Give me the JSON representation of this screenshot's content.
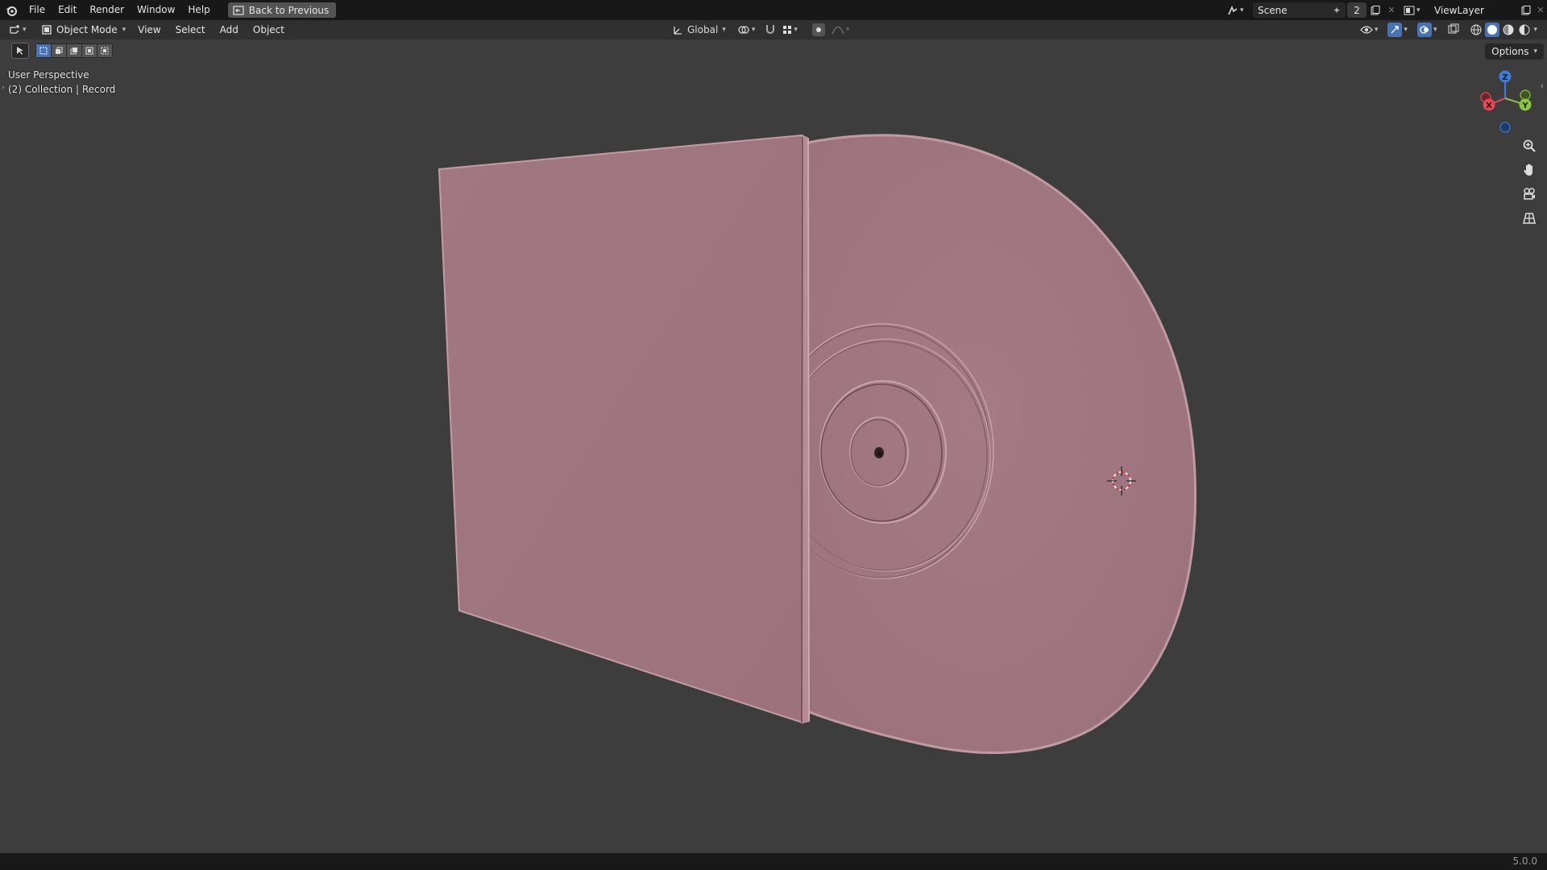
{
  "topbar": {
    "menus": [
      "File",
      "Edit",
      "Render",
      "Window",
      "Help"
    ],
    "back_button": "Back to Previous",
    "scene_name": "Scene",
    "scene_count": "2",
    "view_layer": "ViewLayer"
  },
  "header": {
    "mode": "Object Mode",
    "menus": [
      "View",
      "Select",
      "Add",
      "Object"
    ],
    "transform_orientation": "Global"
  },
  "viewport": {
    "view_name": "User Perspective",
    "collection_info": "(2) Collection | Record",
    "options_label": "Options",
    "gizmo_axes": [
      "X",
      "Y",
      "Z"
    ],
    "object_color": "#a07680",
    "background_color": "#3d3d3d"
  },
  "statusbar": {
    "version": "5.0.0"
  },
  "colors": {
    "accent": "#4772b3",
    "axis_x": "#e84556",
    "axis_y": "#8bc53f",
    "axis_z": "#3d7cdb"
  }
}
